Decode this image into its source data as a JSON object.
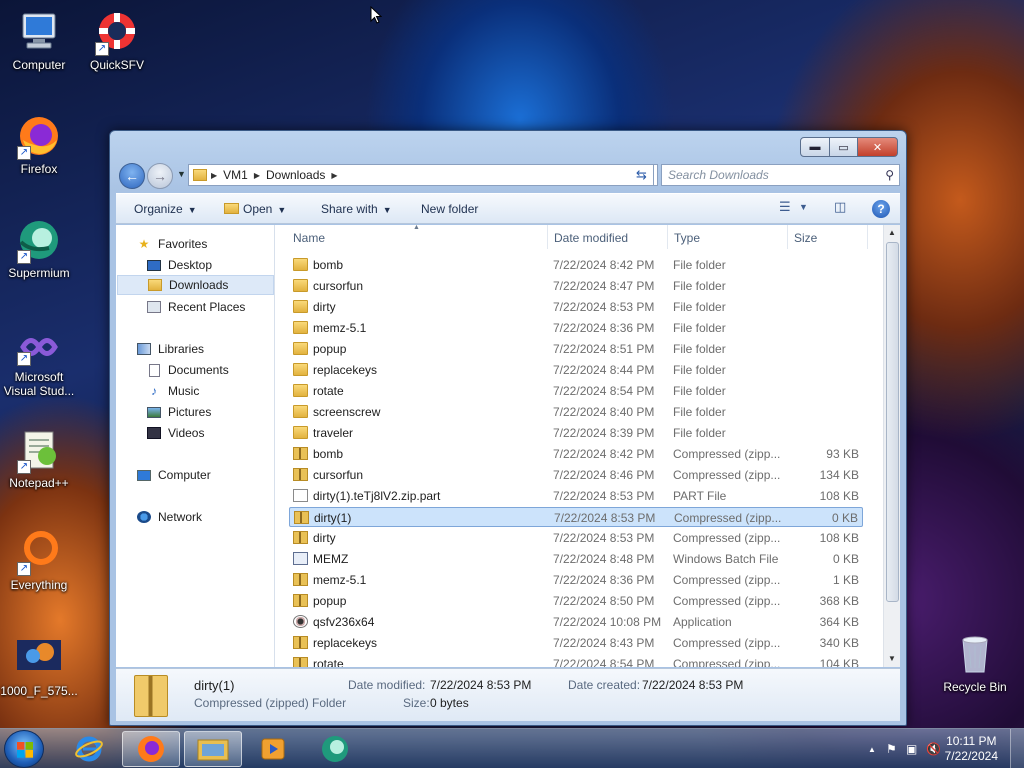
{
  "desktop": {
    "icons": [
      {
        "label": "Computer"
      },
      {
        "label": "QuickSFV"
      },
      {
        "label": "Firefox"
      },
      {
        "label": "Supermium"
      },
      {
        "label": "Microsoft Visual Stud..."
      },
      {
        "label": "Notepad++"
      },
      {
        "label": "Everything"
      },
      {
        "label": "1000_F_575..."
      },
      {
        "label": "Recycle Bin"
      }
    ]
  },
  "window": {
    "controls": {
      "minimize": "▬",
      "maximize": "▭",
      "close": "✕"
    },
    "address": {
      "crumbs": [
        "VM1",
        "Downloads"
      ]
    },
    "search": {
      "placeholder": "Search Downloads"
    },
    "toolbar": {
      "organize": "Organize",
      "open": "Open",
      "share_with": "Share with",
      "new_folder": "New folder",
      "help": "?"
    },
    "nav": {
      "favorites": "Favorites",
      "desktop": "Desktop",
      "downloads": "Downloads",
      "recent_places": "Recent Places",
      "libraries": "Libraries",
      "documents": "Documents",
      "music": "Music",
      "pictures": "Pictures",
      "videos": "Videos",
      "computer": "Computer",
      "network": "Network"
    },
    "columns": {
      "name": "Name",
      "date": "Date modified",
      "type": "Type",
      "size": "Size"
    },
    "files": [
      {
        "name": "bomb",
        "date": "7/22/2024 8:42 PM",
        "type": "File folder",
        "size": "",
        "icon": "folder"
      },
      {
        "name": "cursorfun",
        "date": "7/22/2024 8:47 PM",
        "type": "File folder",
        "size": "",
        "icon": "folder"
      },
      {
        "name": "dirty",
        "date": "7/22/2024 8:53 PM",
        "type": "File folder",
        "size": "",
        "icon": "folder"
      },
      {
        "name": "memz-5.1",
        "date": "7/22/2024 8:36 PM",
        "type": "File folder",
        "size": "",
        "icon": "folder"
      },
      {
        "name": "popup",
        "date": "7/22/2024 8:51 PM",
        "type": "File folder",
        "size": "",
        "icon": "folder"
      },
      {
        "name": "replacekeys",
        "date": "7/22/2024 8:44 PM",
        "type": "File folder",
        "size": "",
        "icon": "folder"
      },
      {
        "name": "rotate",
        "date": "7/22/2024 8:54 PM",
        "type": "File folder",
        "size": "",
        "icon": "folder"
      },
      {
        "name": "screenscrew",
        "date": "7/22/2024 8:40 PM",
        "type": "File folder",
        "size": "",
        "icon": "folder"
      },
      {
        "name": "traveler",
        "date": "7/22/2024 8:39 PM",
        "type": "File folder",
        "size": "",
        "icon": "folder"
      },
      {
        "name": "bomb",
        "date": "7/22/2024 8:42 PM",
        "type": "Compressed (zipp...",
        "size": "93 KB",
        "icon": "zip"
      },
      {
        "name": "cursorfun",
        "date": "7/22/2024 8:46 PM",
        "type": "Compressed (zipp...",
        "size": "134 KB",
        "icon": "zip"
      },
      {
        "name": "dirty(1).teTj8lV2.zip.part",
        "date": "7/22/2024 8:53 PM",
        "type": "PART File",
        "size": "108 KB",
        "icon": "part"
      },
      {
        "name": "dirty(1)",
        "date": "7/22/2024 8:53 PM",
        "type": "Compressed (zipp...",
        "size": "0 KB",
        "icon": "zip",
        "selected": true
      },
      {
        "name": "dirty",
        "date": "7/22/2024 8:53 PM",
        "type": "Compressed (zipp...",
        "size": "108 KB",
        "icon": "zip"
      },
      {
        "name": "MEMZ",
        "date": "7/22/2024 8:48 PM",
        "type": "Windows Batch File",
        "size": "0 KB",
        "icon": "bat"
      },
      {
        "name": "memz-5.1",
        "date": "7/22/2024 8:36 PM",
        "type": "Compressed (zipp...",
        "size": "1 KB",
        "icon": "zip"
      },
      {
        "name": "popup",
        "date": "7/22/2024 8:50 PM",
        "type": "Compressed (zipp...",
        "size": "368 KB",
        "icon": "zip"
      },
      {
        "name": "qsfv236x64",
        "date": "7/22/2024 10:08 PM",
        "type": "Application",
        "size": "364 KB",
        "icon": "app"
      },
      {
        "name": "replacekeys",
        "date": "7/22/2024 8:43 PM",
        "type": "Compressed (zipp...",
        "size": "340 KB",
        "icon": "zip"
      },
      {
        "name": "rotate",
        "date": "7/22/2024 8:54 PM",
        "type": "Compressed (zipp...",
        "size": "104 KB",
        "icon": "zip"
      }
    ],
    "details": {
      "name": "dirty(1)",
      "type": "Compressed (zipped) Folder",
      "date_modified_label": "Date modified:",
      "date_modified": "7/22/2024 8:53 PM",
      "date_created_label": "Date created:",
      "date_created": "7/22/2024 8:53 PM",
      "size_label": "Size:",
      "size": "0 bytes"
    }
  },
  "taskbar": {
    "clock_time": "10:11 PM",
    "clock_date": "7/22/2024"
  }
}
